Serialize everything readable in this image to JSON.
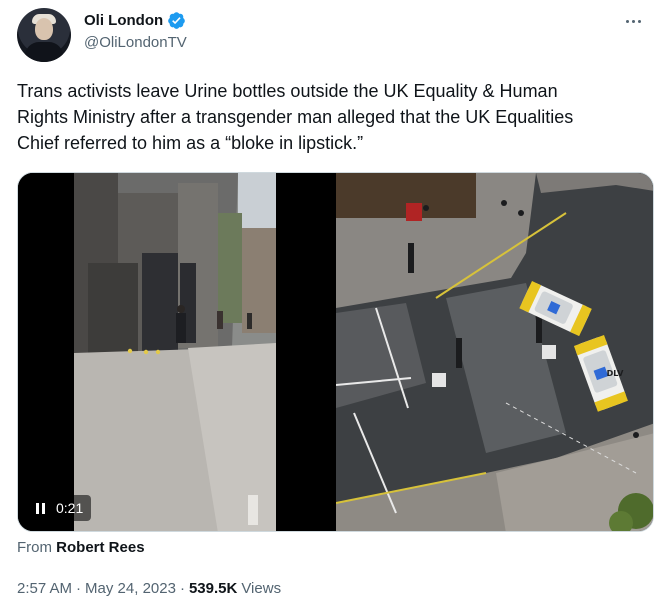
{
  "author": {
    "display_name": "Oli London",
    "handle": "@OliLondonTV",
    "verified": true,
    "avatar_icon": "user-avatar"
  },
  "tweet": {
    "text_line1": "Trans activists leave Urine bottles outside the UK Equality & Human",
    "text_line2": "Rights Ministry after a transgender man alleged that the UK Equalities",
    "text_line3": "Chief referred to him as a “bloke in lipstick.”"
  },
  "media": {
    "video_duration": "0:21",
    "police_car_text": "DLV"
  },
  "attribution": {
    "from_label": "From",
    "source_name": "Robert Rees"
  },
  "meta": {
    "time": "2:57 AM",
    "separator": "·",
    "date": "May 24, 2023",
    "views_count": "539.5K",
    "views_label": "Views"
  },
  "colors": {
    "verified_blue": "#1d9bf0",
    "text_primary": "#0f1419",
    "text_secondary": "#536471",
    "border": "#cfd9de"
  }
}
